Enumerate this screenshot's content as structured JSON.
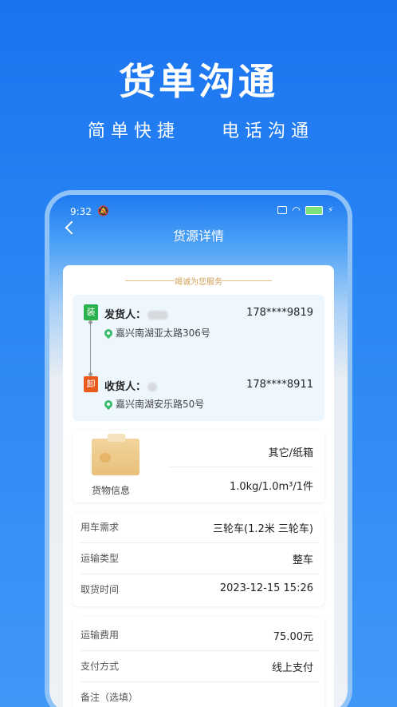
{
  "hero": {
    "title": "货单沟通",
    "sub_left": "简单快捷",
    "sub_right": "电话沟通"
  },
  "statusbar": {
    "time": "9:32"
  },
  "nav": {
    "title": "货源详情"
  },
  "card": {
    "slogan": "竭诚为您服务",
    "route": {
      "load_tag": "装",
      "unload_tag": "卸",
      "sender_label": "发货人：",
      "sender_phone": "178****9819",
      "sender_address": "嘉兴南湖亚太路306号",
      "receiver_label": "收货人：",
      "receiver_phone": "178****8911",
      "receiver_address": "嘉兴南湖安乐路50号"
    },
    "goods": {
      "label": "货物信息",
      "type": "其它/纸箱",
      "spec": "1.0kg/1.0m³/1件"
    },
    "details": [
      {
        "label": "用车需求",
        "value": "三轮车(1.2米 三轮车)"
      },
      {
        "label": "运输类型",
        "value": "整车"
      },
      {
        "label": "取货时间",
        "value": "2023-12-15 15:26"
      }
    ],
    "payment": [
      {
        "label": "运输费用",
        "value": "75.00元"
      },
      {
        "label": "支付方式",
        "value": "线上支付"
      },
      {
        "label": "备注（选填）",
        "value": ""
      }
    ]
  },
  "colors": {
    "brand_blue": "#1a73ef",
    "load_green": "#2bb24c",
    "unload_orange": "#ea5a1d",
    "slogan_gold": "#d29e55"
  }
}
